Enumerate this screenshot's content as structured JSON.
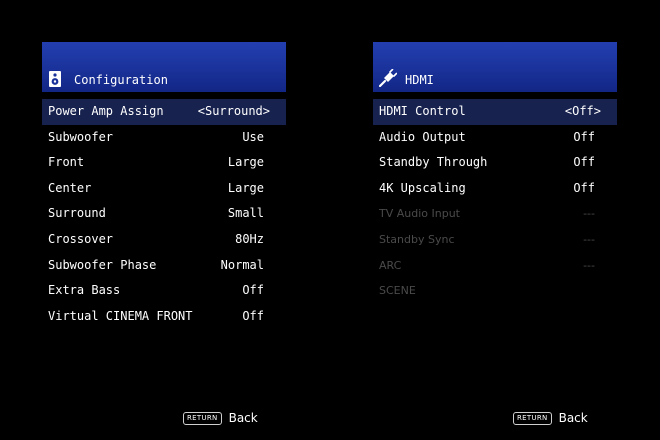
{
  "left_panel": {
    "title": "Configuration",
    "icon": "speaker-icon",
    "items": [
      {
        "label": "Power Amp Assign",
        "value": "<Surround>",
        "selected": true
      },
      {
        "label": "Subwoofer",
        "value": "Use"
      },
      {
        "label": "Front",
        "value": "Large"
      },
      {
        "label": "Center",
        "value": "Large"
      },
      {
        "label": "Surround",
        "value": "Small"
      },
      {
        "label": "Crossover",
        "value": "80Hz"
      },
      {
        "label": "Subwoofer Phase",
        "value": "Normal"
      },
      {
        "label": "Extra Bass",
        "value": "Off"
      },
      {
        "label": "Virtual CINEMA FRONT",
        "value": "Off"
      }
    ],
    "return_key": "RETURN",
    "return_label": "Back"
  },
  "right_panel": {
    "title": "HDMI",
    "icon": "hdmi-plug-icon",
    "items": [
      {
        "label": "HDMI Control",
        "value": "<Off>",
        "selected": true
      },
      {
        "label": "Audio Output",
        "value": "Off"
      },
      {
        "label": "Standby Through",
        "value": "Off"
      },
      {
        "label": "4K Upscaling",
        "value": "Off"
      },
      {
        "label": "TV Audio Input",
        "value": "---",
        "disabled": true
      },
      {
        "label": "Standby Sync",
        "value": "---",
        "disabled": true
      },
      {
        "label": "ARC",
        "value": "---",
        "disabled": true
      },
      {
        "label": "SCENE",
        "value": "",
        "disabled": true
      }
    ],
    "return_key": "RETURN",
    "return_label": "Back"
  },
  "colors": {
    "background": "#000000",
    "header_blue": "#1a329a",
    "selected_row": "#17224e",
    "disabled_text": "#4a4a4a"
  }
}
